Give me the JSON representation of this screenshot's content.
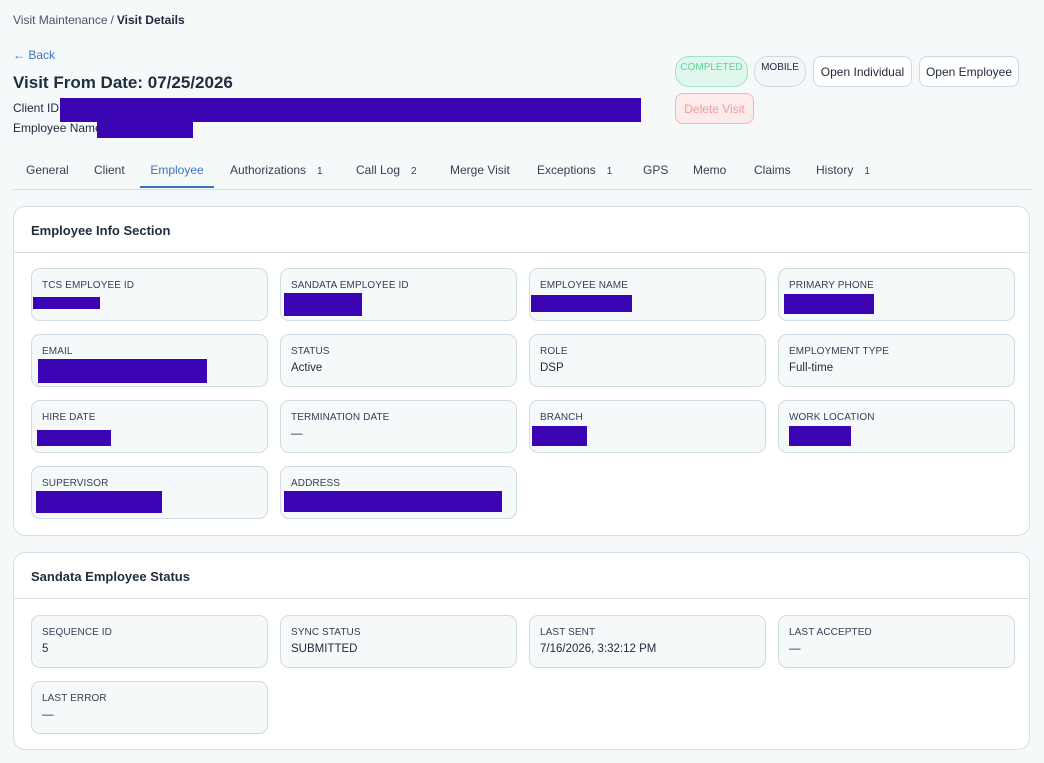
{
  "breadcrumb": {
    "parent": "Visit Maintenance",
    "separator": "/",
    "current": "Visit Details"
  },
  "back_label": "← Back",
  "title": "Visit From Date: 07/25/2026",
  "client_id_label": "Client ID:",
  "employee_name_label": "Employee Name:",
  "badges": {
    "status": "COMPLETED",
    "source": "MOBILE"
  },
  "buttons": {
    "open_individual": "Open Individual",
    "open_employee": "Open Employee",
    "delete_visit": "Delete Visit"
  },
  "tabs": [
    {
      "label": "General",
      "count": ""
    },
    {
      "label": "Client",
      "count": ""
    },
    {
      "label": "Employee",
      "count": "",
      "active": true
    },
    {
      "label": "Authorizations",
      "count": "1"
    },
    {
      "label": "Call Log",
      "count": "2"
    },
    {
      "label": "Merge Visit",
      "count": ""
    },
    {
      "label": "Exceptions",
      "count": "1"
    },
    {
      "label": "GPS",
      "count": ""
    },
    {
      "label": "Memo",
      "count": ""
    },
    {
      "label": "Claims",
      "count": ""
    },
    {
      "label": "History",
      "count": "1"
    }
  ],
  "employee_info": {
    "title": "Employee Info Section",
    "fields": {
      "tcs_employee_id": {
        "label": "TCS EMPLOYEE ID",
        "value": ""
      },
      "sandata_employee_id": {
        "label": "SANDATA EMPLOYEE ID",
        "value": ""
      },
      "employee_name": {
        "label": "EMPLOYEE NAME",
        "value": ""
      },
      "primary_phone": {
        "label": "PRIMARY PHONE",
        "value": ""
      },
      "email": {
        "label": "EMAIL",
        "value": ""
      },
      "status": {
        "label": "STATUS",
        "value": "Active"
      },
      "role": {
        "label": "ROLE",
        "value": "DSP"
      },
      "employment_type": {
        "label": "EMPLOYMENT TYPE",
        "value": "Full-time"
      },
      "hire_date": {
        "label": "HIRE DATE",
        "value": ""
      },
      "termination_date": {
        "label": "TERMINATION DATE",
        "value": "—"
      },
      "branch": {
        "label": "BRANCH",
        "value": ""
      },
      "work_location": {
        "label": "WORK LOCATION",
        "value": ""
      },
      "supervisor": {
        "label": "SUPERVISOR",
        "value": ""
      },
      "address": {
        "label": "ADDRESS",
        "value": ""
      }
    }
  },
  "sandata_status": {
    "title": "Sandata Employee Status",
    "fields": {
      "sequence_id": {
        "label": "SEQUENCE ID",
        "value": "5"
      },
      "sync_status": {
        "label": "SYNC STATUS",
        "value": "SUBMITTED"
      },
      "last_sent": {
        "label": "LAST SENT",
        "value": "7/16/2026, 3:32:12 PM"
      },
      "last_accepted": {
        "label": "LAST ACCEPTED",
        "value": "—"
      },
      "last_error": {
        "label": "LAST ERROR",
        "value": "—"
      }
    }
  },
  "colors": {
    "accent": "#3b74c5",
    "redaction": "#3c05b3",
    "completed_text": "#5cd49c",
    "delete_text": "#f19a9a"
  }
}
